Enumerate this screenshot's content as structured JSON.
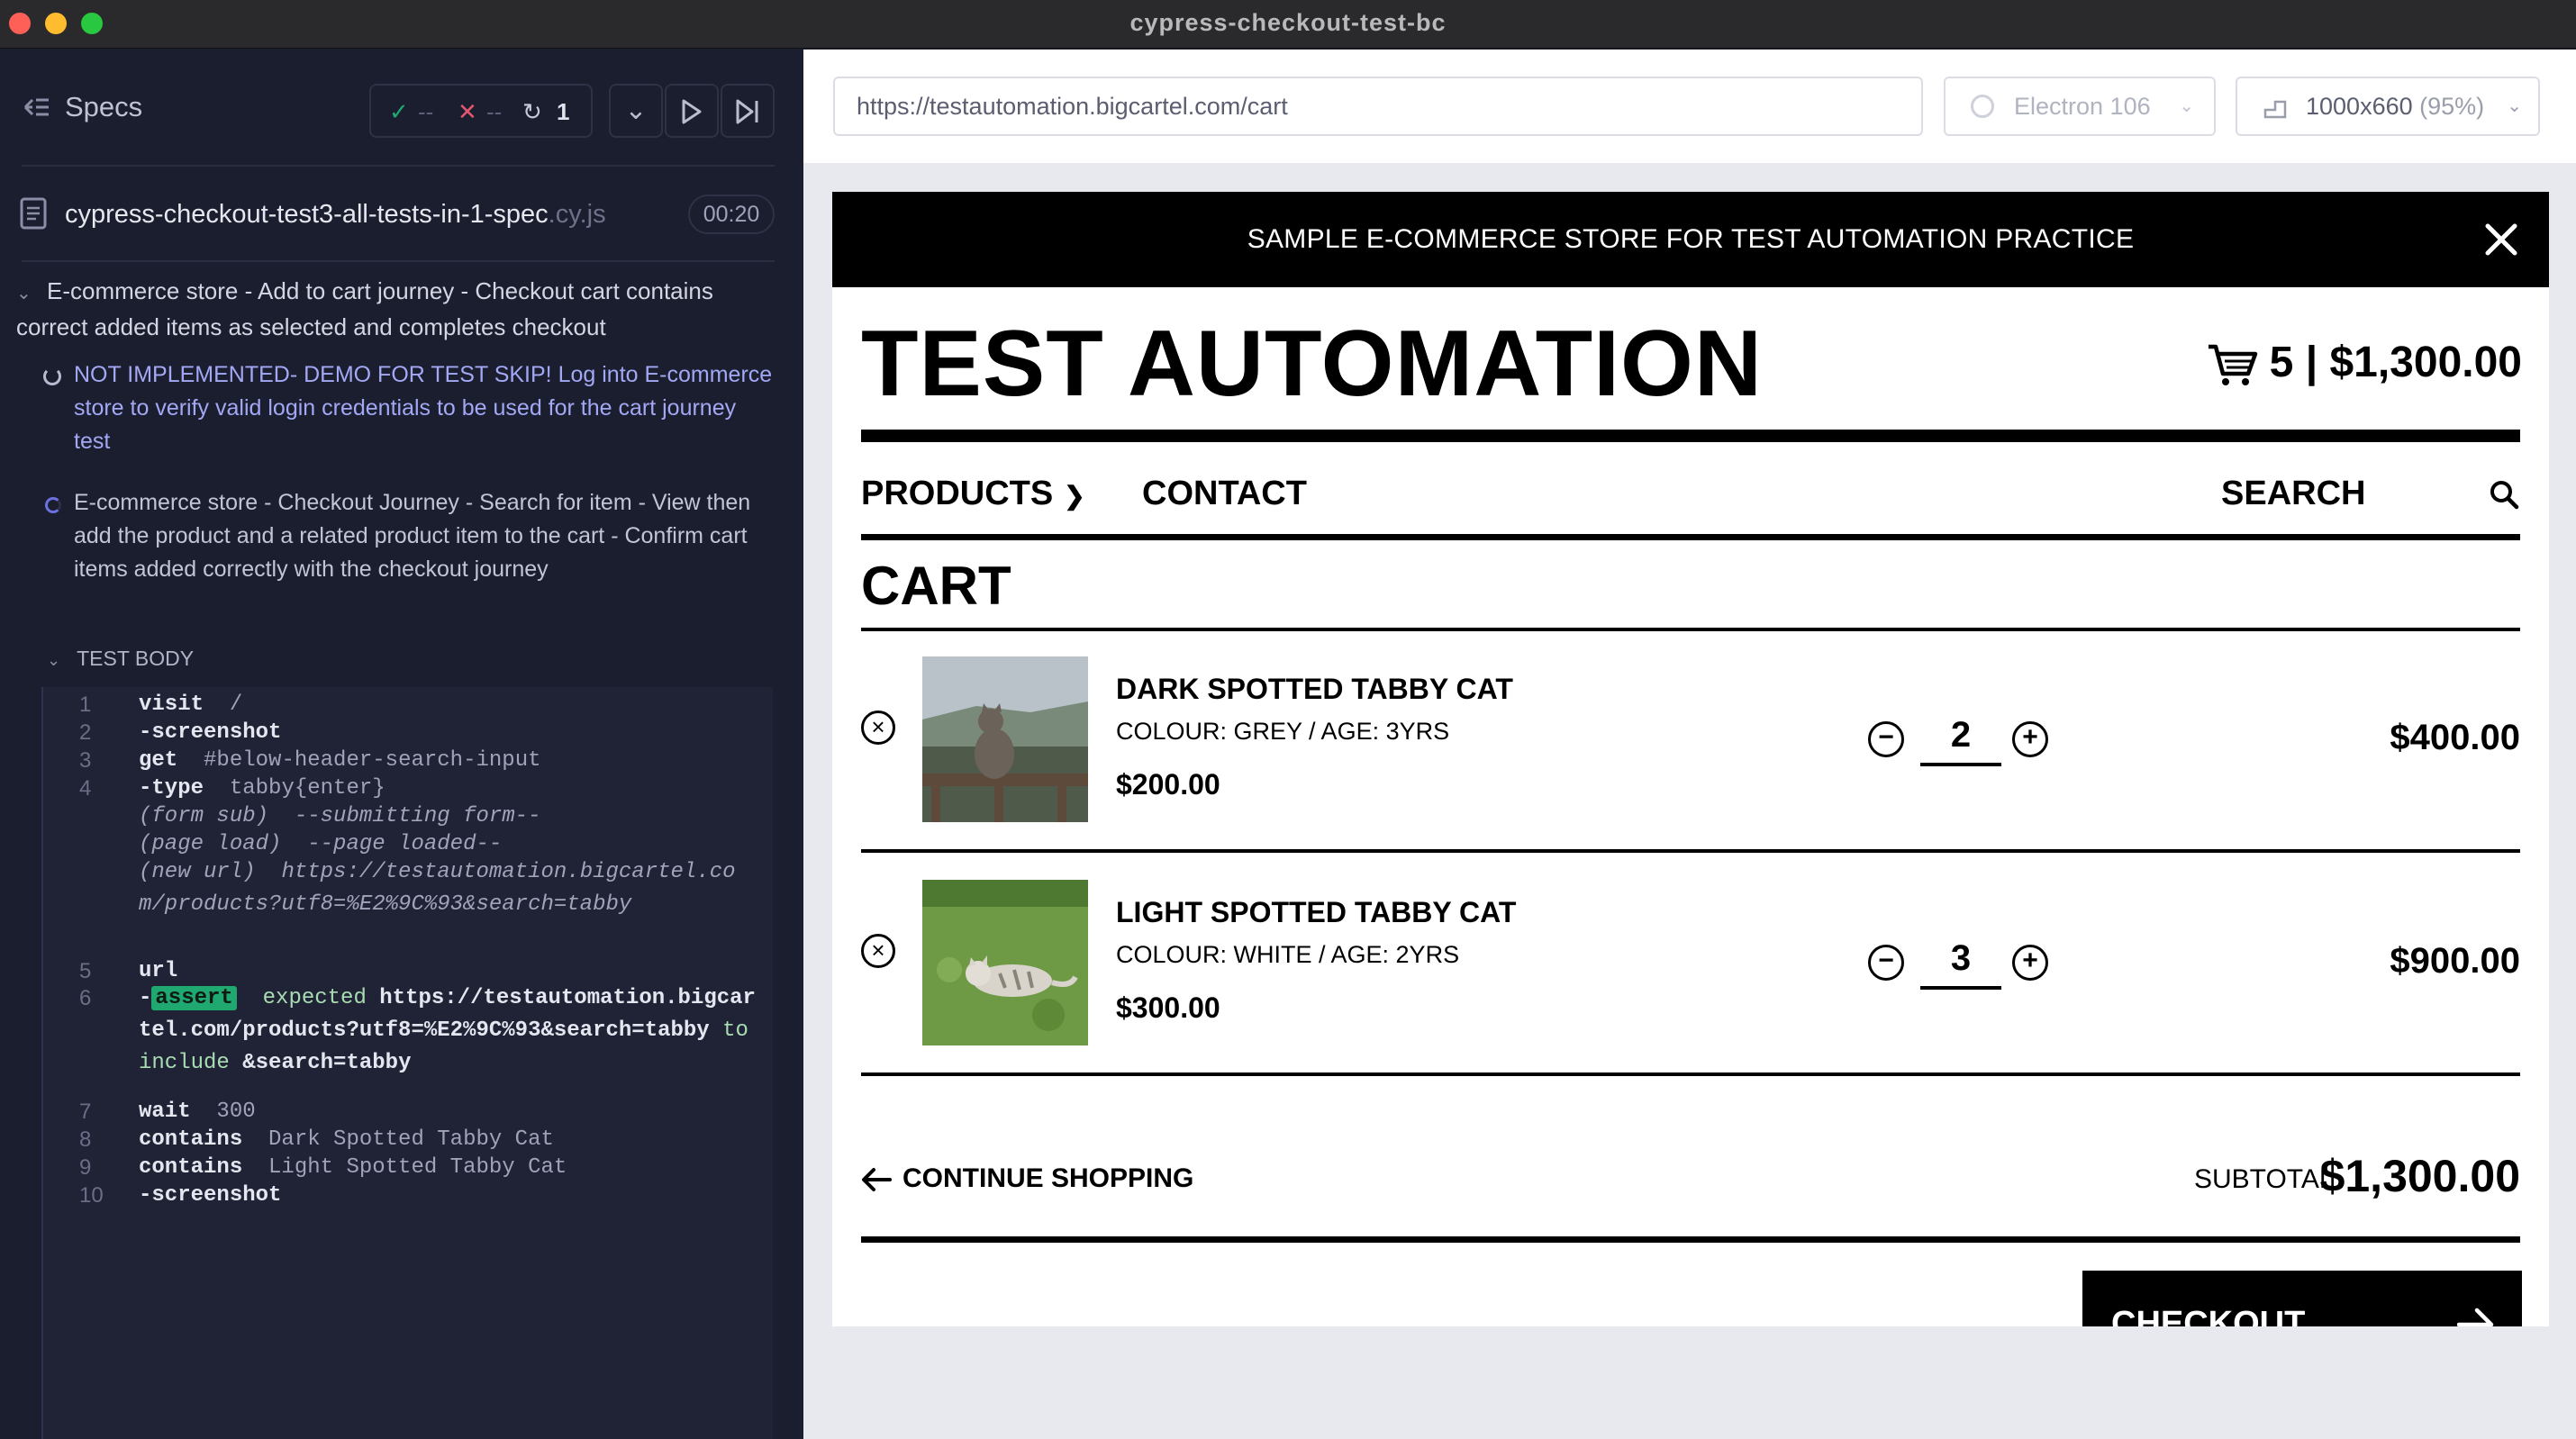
{
  "window": {
    "title": "cypress-checkout-test-bc"
  },
  "reporter": {
    "specs_label": "Specs",
    "stats": {
      "passed": "--",
      "failed": "--",
      "pending": "1"
    },
    "spec_file": {
      "name": "cypress-checkout-test3-all-tests-in-1-spec",
      "ext": ".cy.js",
      "duration": "00:20"
    },
    "suite_title": "E-commerce store - Add to cart journey - Checkout cart contains correct added items as selected and completes checkout",
    "tests": [
      {
        "title": "NOT IMPLEMENTED- DEMO FOR TEST SKIP! Log into E-commerce store to verify valid login credentials to be used for the cart journey test",
        "state": "pending"
      },
      {
        "title": "E-commerce store - Checkout Journey - Search for item - View then add the product and a related product item to the cart - Confirm cart items added correctly with the checkout journey",
        "state": "running"
      }
    ],
    "test_body_label": "TEST BODY",
    "commands": [
      {
        "num": "1",
        "name": "visit",
        "arg": "/"
      },
      {
        "num": "2",
        "name": "-screenshot",
        "arg": ""
      },
      {
        "num": "3",
        "name": "get",
        "arg": "#below-header-search-input"
      },
      {
        "num": "4",
        "name": "-type",
        "arg": "tabby{enter}"
      },
      {
        "num": "",
        "event": "(form sub)",
        "msg": "--submitting form--"
      },
      {
        "num": "",
        "event": "(page load)",
        "msg": "--page loaded--"
      },
      {
        "num": "",
        "event": "(new url)",
        "msg": "https://testautomation.bigcartel.com/products?utf8=%E2%9C%93&search=tabby"
      },
      {
        "num": "5",
        "name": "url",
        "arg": ""
      },
      {
        "num": "6",
        "name": "-",
        "badge": "assert",
        "expected_label": "expected",
        "expected_value": "https://testautomation.bigcartel.com/products?utf8=%E2%9C%93&search=tabby",
        "to_include": "to include",
        "include_value": "&search=tabby"
      },
      {
        "num": "7",
        "name": "wait",
        "arg": "300"
      },
      {
        "num": "8",
        "name": "contains",
        "arg": "Dark Spotted Tabby Cat"
      },
      {
        "num": "9",
        "name": "contains",
        "arg": "Light Spotted Tabby Cat"
      },
      {
        "num": "10",
        "name": "-screenshot",
        "arg": ""
      }
    ]
  },
  "aut": {
    "url": "https://testautomation.bigcartel.com/cart",
    "browser": "Electron 106",
    "viewport": "1000x660",
    "scale": "(95%)",
    "site": {
      "banner": "SAMPLE E-COMMERCE STORE FOR TEST AUTOMATION PRACTICE",
      "store_title": "TEST AUTOMATION",
      "cart_summary": "5 | $1,300.00",
      "nav": {
        "products": "PRODUCTS",
        "contact": "CONTACT",
        "search": "SEARCH"
      },
      "cart_heading": "CART",
      "items": [
        {
          "name": "DARK SPOTTED TABBY CAT",
          "option": "COLOUR: GREY / AGE: 3YRS",
          "unit_price": "$200.00",
          "qty": "2",
          "total": "$400.00"
        },
        {
          "name": "LIGHT SPOTTED TABBY CAT",
          "option": "COLOUR: WHITE / AGE: 2YRS",
          "unit_price": "$300.00",
          "qty": "3",
          "total": "$900.00"
        }
      ],
      "continue_shopping": "CONTINUE SHOPPING",
      "subtotal_label": "SUBTOTAL",
      "subtotal_value": "$1,300.00",
      "checkout": "CHECKOUT"
    }
  },
  "colors": {
    "pass": "#1fa971",
    "fail": "#e45770",
    "pending_link": "#a3a8f5",
    "reporter_bg": "#1b1e2e"
  }
}
